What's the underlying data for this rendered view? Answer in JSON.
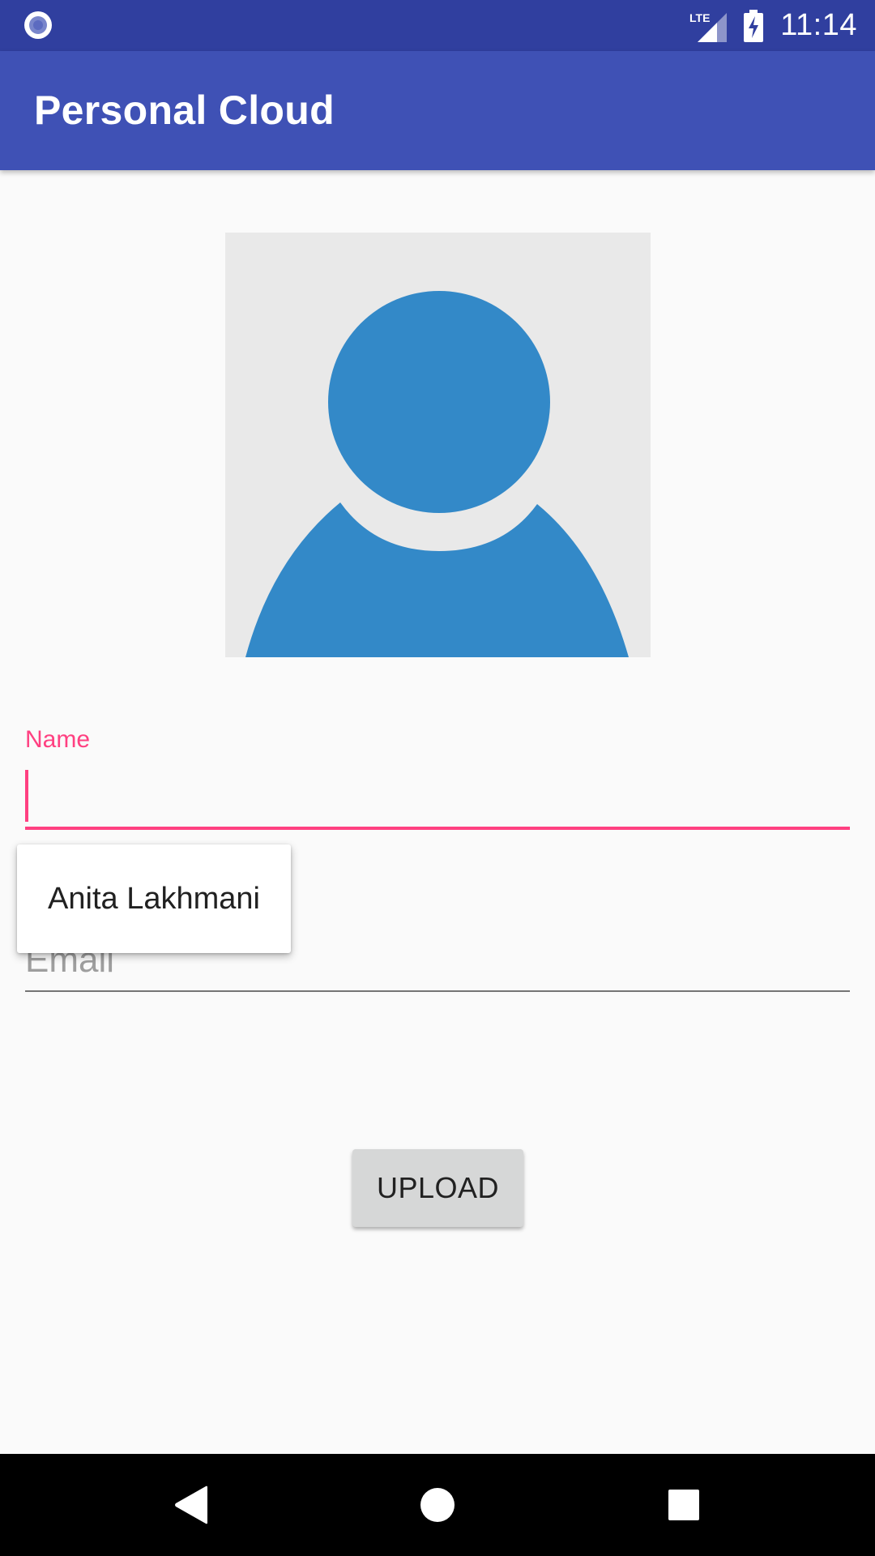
{
  "status_bar": {
    "time": "11:14",
    "network_label": "LTE",
    "icons": [
      "notification-circle-icon",
      "lte-signal-icon",
      "battery-charging-icon"
    ]
  },
  "app_bar": {
    "title": "Personal Cloud"
  },
  "profile": {
    "avatar_icon": "person-placeholder-icon",
    "colors": {
      "avatar_bg": "#e9e9e9",
      "avatar_fg": "#3389c8"
    }
  },
  "form": {
    "name_label": "Name",
    "name_value": "",
    "email_placeholder": "Email",
    "email_value": "",
    "suggestions": [
      "Anita Lakhmani"
    ]
  },
  "actions": {
    "upload_label": "UPLOAD"
  },
  "nav_bar": {
    "icons": [
      "back-icon",
      "home-icon",
      "recents-icon"
    ]
  },
  "theme": {
    "primary": "#3f51b5",
    "primary_dark": "#303f9f",
    "accent": "#ff4081",
    "background": "#fafafa"
  }
}
